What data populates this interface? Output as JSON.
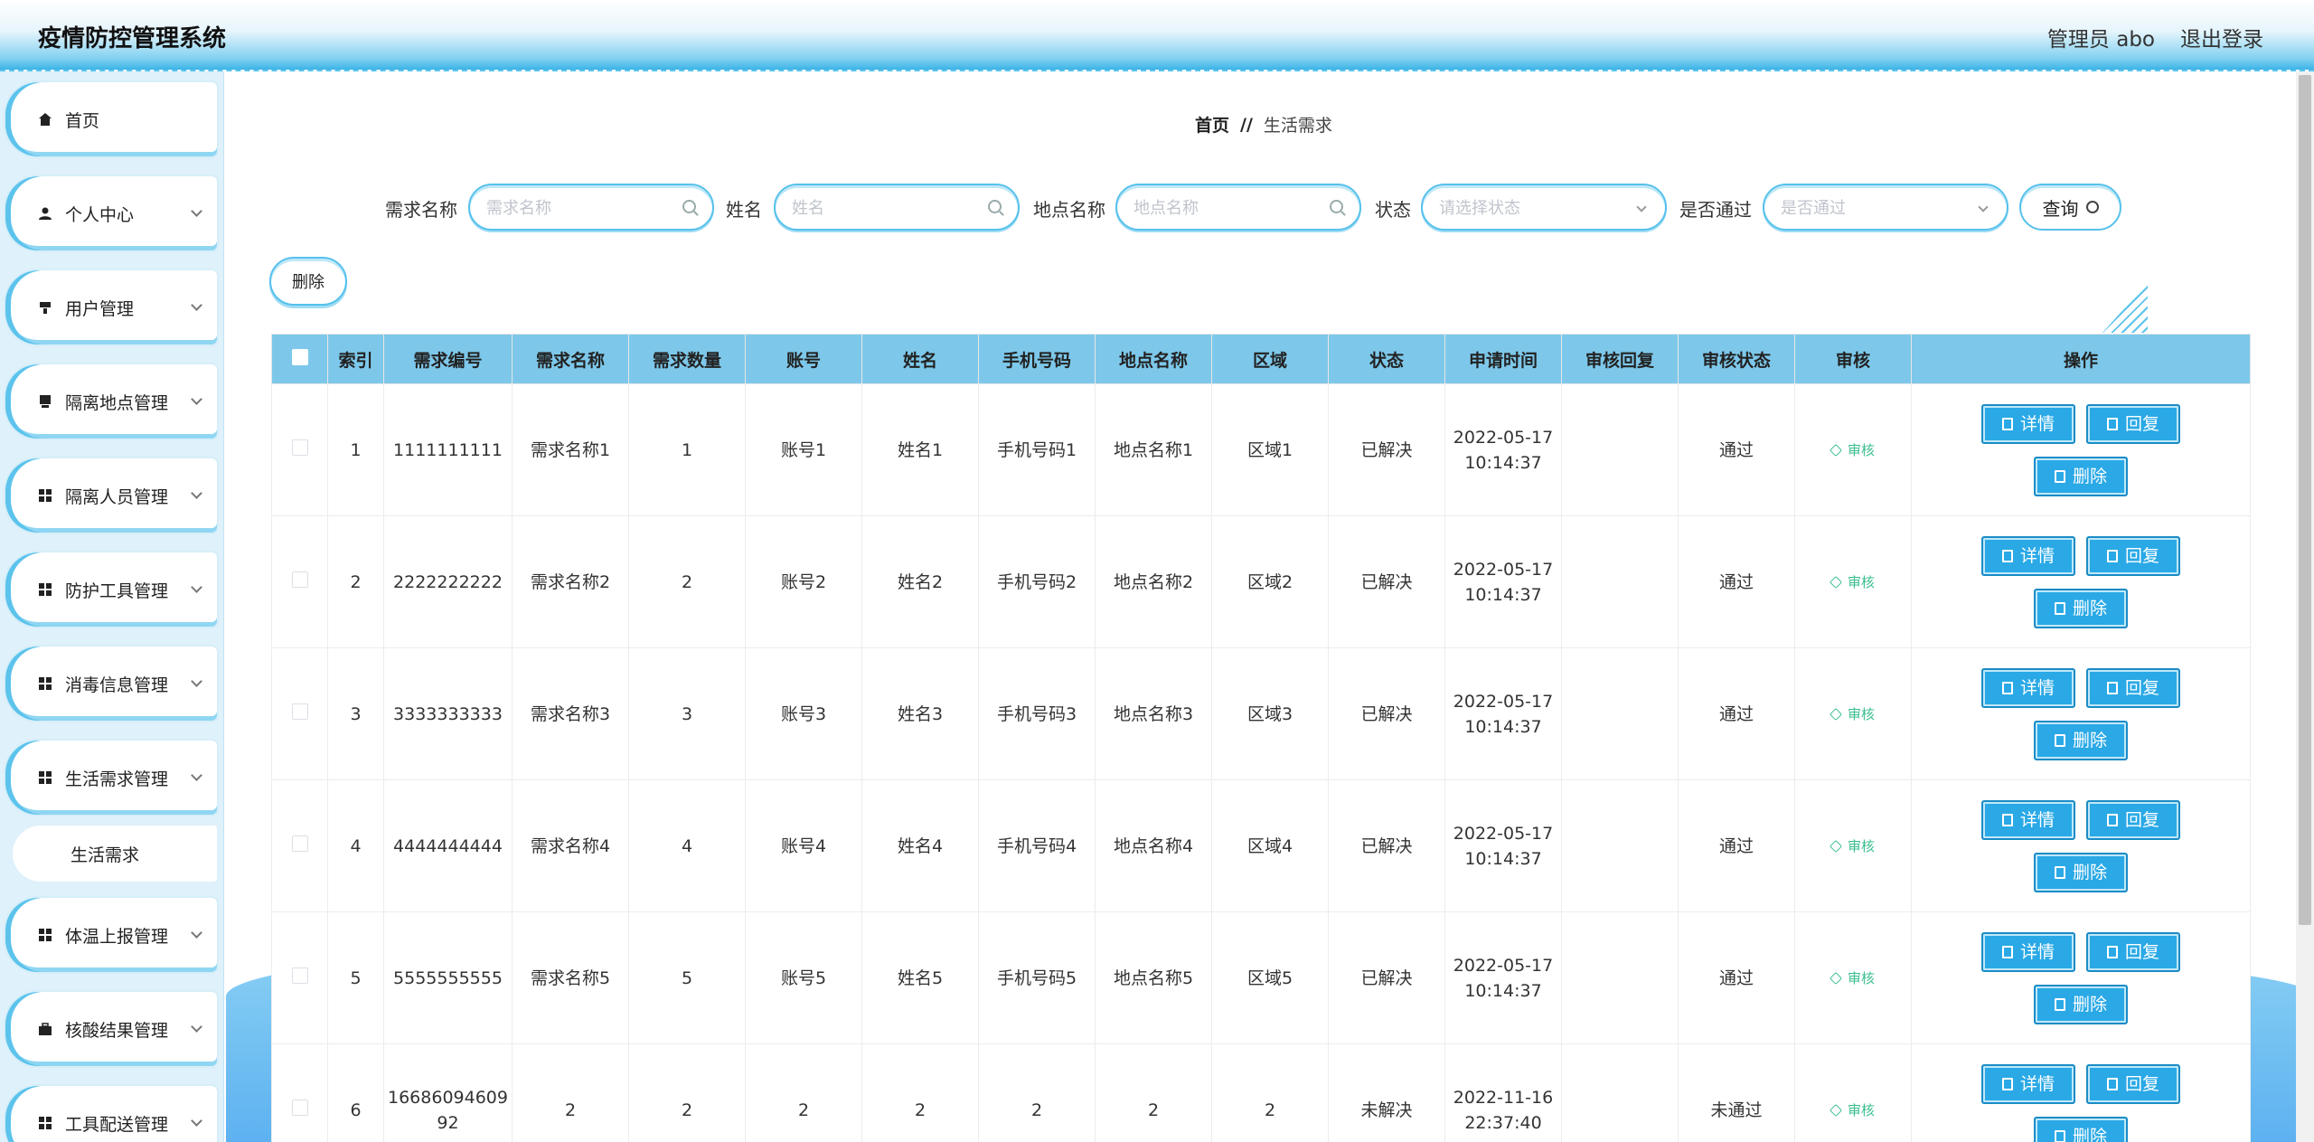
{
  "app": {
    "title": "疫情防控管理系统",
    "user": "管理员 abo",
    "logout": "退出登录"
  },
  "sidebar": {
    "items": [
      {
        "label": "首页",
        "icon": "home-icon"
      },
      {
        "label": "个人中心",
        "icon": "person-icon"
      },
      {
        "label": "用户管理",
        "icon": "user-mgmt-icon"
      },
      {
        "label": "隔离地点管理",
        "icon": "location-icon"
      },
      {
        "label": "隔离人员管理",
        "icon": "grid-icon"
      },
      {
        "label": "防护工具管理",
        "icon": "grid-icon"
      },
      {
        "label": "消毒信息管理",
        "icon": "grid-icon"
      },
      {
        "label": "生活需求管理",
        "icon": "grid-icon"
      },
      {
        "label": "体温上报管理",
        "icon": "grid-icon"
      },
      {
        "label": "核酸结果管理",
        "icon": "briefcase-icon"
      },
      {
        "label": "工具配送管理",
        "icon": "grid-icon"
      }
    ],
    "sub_item": "生活需求"
  },
  "breadcrumb": {
    "home": "首页",
    "sep": "//",
    "current": "生活需求"
  },
  "search": {
    "name_label": "需求名称",
    "name_placeholder": "需求名称",
    "person_label": "姓名",
    "person_placeholder": "姓名",
    "place_label": "地点名称",
    "place_placeholder": "地点名称",
    "status_label": "状态",
    "status_placeholder": "请选择状态",
    "pass_label": "是否通过",
    "pass_placeholder": "是否通过",
    "query": "查询"
  },
  "toolbar": {
    "delete": "删除"
  },
  "table": {
    "headers": [
      "索引",
      "需求编号",
      "需求名称",
      "需求数量",
      "账号",
      "姓名",
      "手机号码",
      "地点名称",
      "区域",
      "状态",
      "申请时间",
      "审核回复",
      "审核状态",
      "审核",
      "操作"
    ],
    "rows": [
      {
        "idx": "1",
        "no": "1111111111",
        "name": "需求名称1",
        "qty": "1",
        "acct": "账号1",
        "person": "姓名1",
        "phone": "手机号码1",
        "place": "地点名称1",
        "area": "区域1",
        "status": "已解决",
        "date": "2022-05-17",
        "time": "10:14:37",
        "reply": "",
        "audit": "通过"
      },
      {
        "idx": "2",
        "no": "2222222222",
        "name": "需求名称2",
        "qty": "2",
        "acct": "账号2",
        "person": "姓名2",
        "phone": "手机号码2",
        "place": "地点名称2",
        "area": "区域2",
        "status": "已解决",
        "date": "2022-05-17",
        "time": "10:14:37",
        "reply": "",
        "audit": "通过"
      },
      {
        "idx": "3",
        "no": "3333333333",
        "name": "需求名称3",
        "qty": "3",
        "acct": "账号3",
        "person": "姓名3",
        "phone": "手机号码3",
        "place": "地点名称3",
        "area": "区域3",
        "status": "已解决",
        "date": "2022-05-17",
        "time": "10:14:37",
        "reply": "",
        "audit": "通过"
      },
      {
        "idx": "4",
        "no": "4444444444",
        "name": "需求名称4",
        "qty": "4",
        "acct": "账号4",
        "person": "姓名4",
        "phone": "手机号码4",
        "place": "地点名称4",
        "area": "区域4",
        "status": "已解决",
        "date": "2022-05-17",
        "time": "10:14:37",
        "reply": "",
        "audit": "通过"
      },
      {
        "idx": "5",
        "no": "5555555555",
        "name": "需求名称5",
        "qty": "5",
        "acct": "账号5",
        "person": "姓名5",
        "phone": "手机号码5",
        "place": "地点名称5",
        "area": "区域5",
        "status": "已解决",
        "date": "2022-05-17",
        "time": "10:14:37",
        "reply": "",
        "audit": "通过"
      },
      {
        "idx": "6",
        "no": "16686094609\n92",
        "name": "2",
        "qty": "2",
        "acct": "2",
        "person": "2",
        "phone": "2",
        "place": "2",
        "area": "2",
        "status": "未解决",
        "date": "2022-11-16",
        "time": "22:37:40",
        "reply": "",
        "audit": "未通过"
      }
    ],
    "audit_link": "审核",
    "op_detail": "详情",
    "op_reply": "回复",
    "op_delete": "删除"
  },
  "colors": {
    "accent": "#2aa9e6",
    "header_row": "#7dc8ea",
    "audit_green": "#3bbf8f"
  }
}
